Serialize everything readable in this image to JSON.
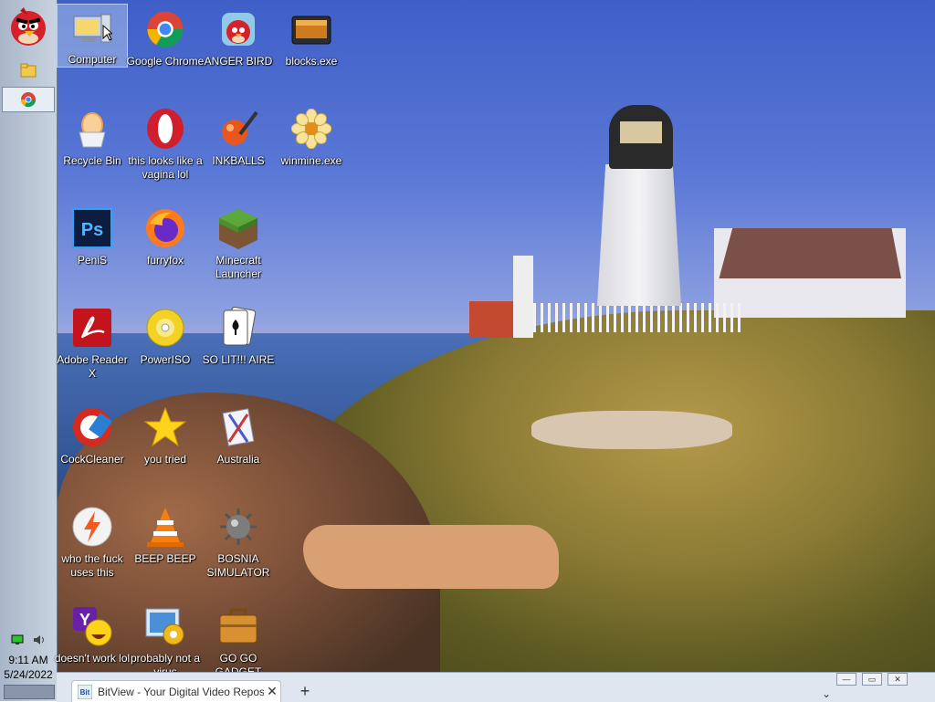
{
  "taskbar": {
    "clock_time": "9:11 AM",
    "clock_date": "5/24/2022",
    "pinned": [
      {
        "icon": "folder-icon"
      },
      {
        "icon": "chrome-icon"
      }
    ]
  },
  "desktop_icons": [
    {
      "label": "Computer",
      "icon": "computer-icon"
    },
    {
      "label": "Google Chrome",
      "icon": "chrome-icon"
    },
    {
      "label": "ANGER BIRD",
      "icon": "angry-bird-icon"
    },
    {
      "label": "blocks.exe",
      "icon": "blocks-icon"
    },
    {
      "label": "Recycle Bin",
      "icon": "recycle-bin-icon"
    },
    {
      "label": "this looks like a vagina lol",
      "icon": "opera-icon"
    },
    {
      "label": "INKBALLS",
      "icon": "inkball-icon"
    },
    {
      "label": "winmine.exe",
      "icon": "flower-icon"
    },
    {
      "label": "PeniS",
      "icon": "photoshop-icon"
    },
    {
      "label": "furryfox",
      "icon": "firefox-icon"
    },
    {
      "label": "Minecraft Launcher",
      "icon": "minecraft-icon"
    },
    {
      "label": "Adobe Reader X",
      "icon": "adobe-reader-icon"
    },
    {
      "label": "PowerISO",
      "icon": "disc-icon"
    },
    {
      "label": "SO LIT!!! AIRE",
      "icon": "cards-icon"
    },
    {
      "label": "CockCleaner",
      "icon": "ccleaner-icon"
    },
    {
      "label": "you tried",
      "icon": "star-icon"
    },
    {
      "label": "Australia",
      "icon": "gift-icon"
    },
    {
      "label": "who the fuck uses this",
      "icon": "winamp-icon"
    },
    {
      "label": "BEEP BEEP",
      "icon": "vlc-icon"
    },
    {
      "label": "BOSNIA SIMULATOR",
      "icon": "mine-icon"
    },
    {
      "label": "doesn't work lol",
      "icon": "yahoo-icon"
    },
    {
      "label": "probably not a virus",
      "icon": "settings-icon"
    },
    {
      "label": "GO GO GADGET",
      "icon": "briefcase-icon"
    }
  ],
  "browser": {
    "tab_title": "BitView - Your Digital Video Repository",
    "new_tab": "+",
    "close_tab": "✕",
    "dropdown": "⌄",
    "minimize": "—",
    "maximize": "▭",
    "close": "✕"
  }
}
